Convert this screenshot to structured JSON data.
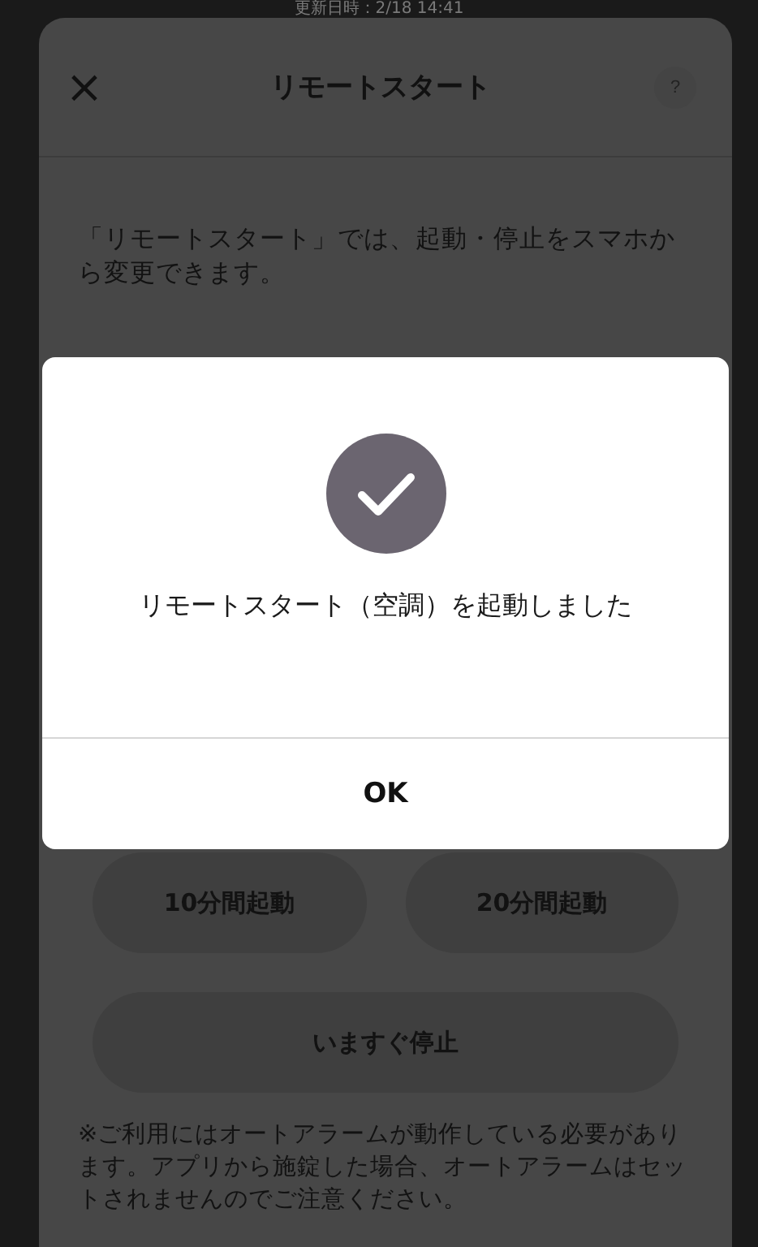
{
  "status_text": "更新日時：2/18 14:41",
  "sheet": {
    "title": "リモートスタート",
    "close": "×",
    "help": "?",
    "description": "「リモートスタート」では、起動・停止をスマホから変更できます。",
    "buttons": [
      {
        "label": "10分間起動"
      },
      {
        "label": "20分間起動"
      }
    ],
    "stop_button": "いますぐ停止",
    "note": "※ご利用にはオートアラームが動作している必要があります。アプリから施錠した場合、オートアラームはセットされませんのでご注意ください。"
  },
  "dialog": {
    "message": "リモートスタート（空調）を起動しました",
    "button": "OK"
  }
}
